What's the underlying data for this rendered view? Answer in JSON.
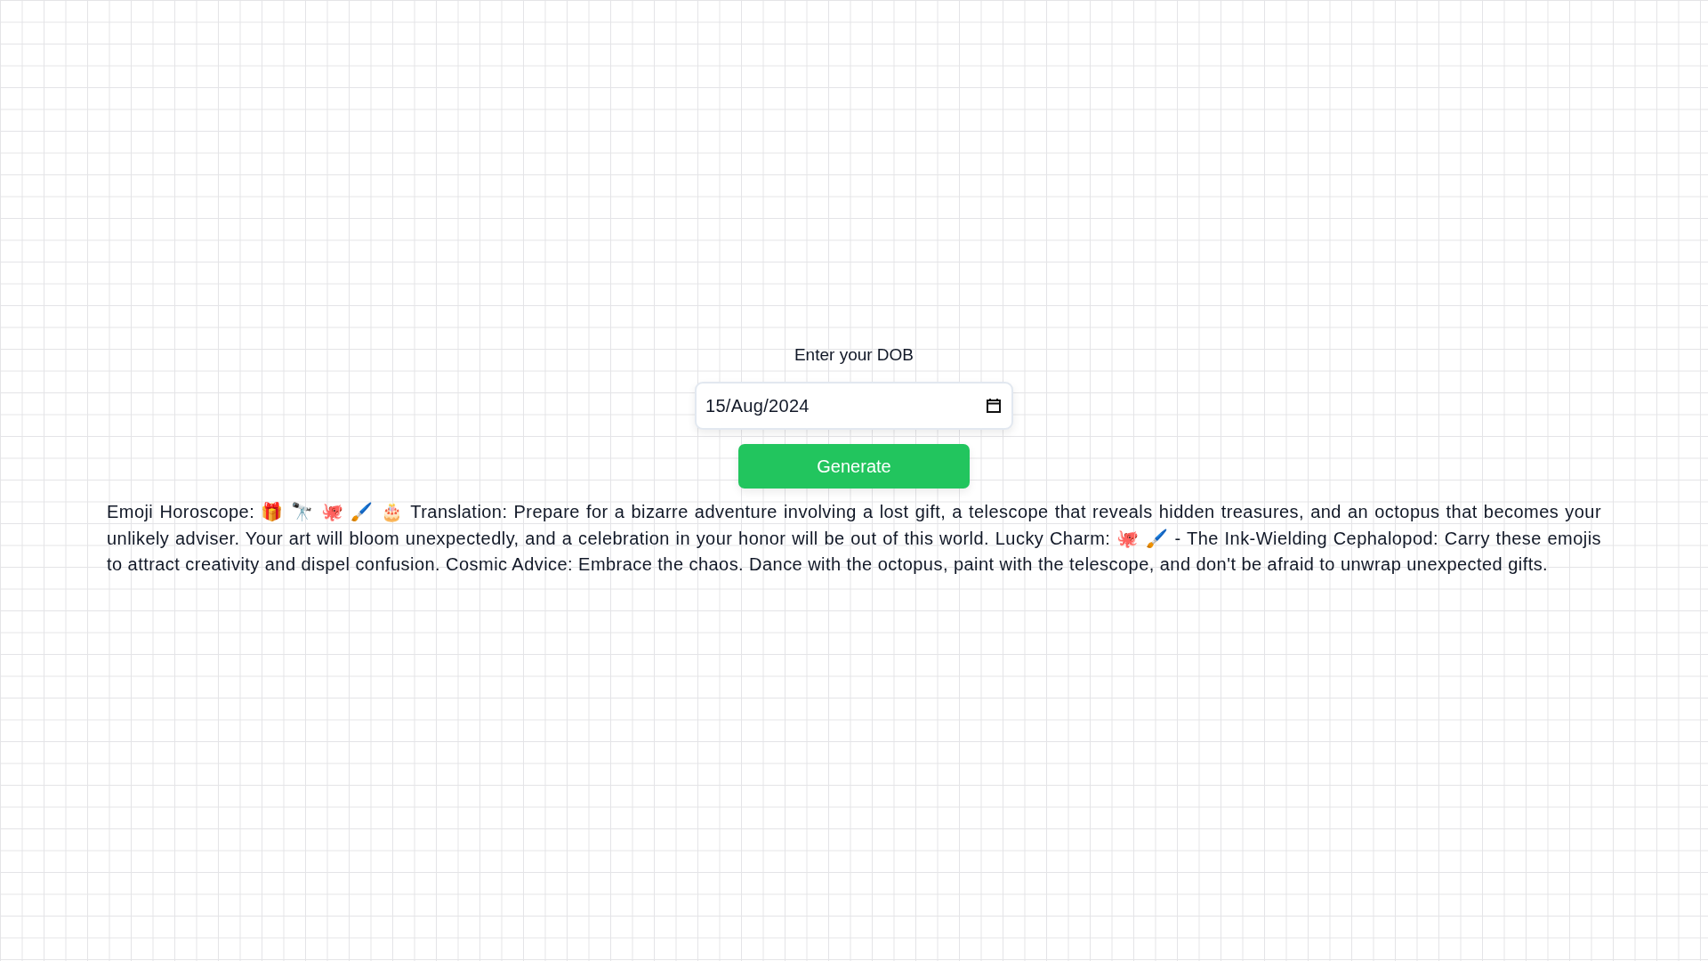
{
  "form": {
    "label": "Enter your DOB",
    "date_field": {
      "value": "15/Aug/2024"
    },
    "button": "Generate"
  },
  "result": {
    "text": "Emoji Horoscope: 🎁 🔭 🐙 🖌️ 🎂 Translation: Prepare for a bizarre adventure involving a lost gift, a telescope that reveals hidden treasures, and an octopus that becomes your unlikely adviser. Your art will bloom unexpectedly, and a celebration in your honor will be out of this world. Lucky Charm: 🐙 🖌️ - The Ink-Wielding Cephalopod: Carry these emojis to attract creativity and dispel confusion. Cosmic Advice: Embrace the chaos. Dance with the octopus, paint with the telescope, and don't be afraid to unwrap unexpected gifts."
  }
}
